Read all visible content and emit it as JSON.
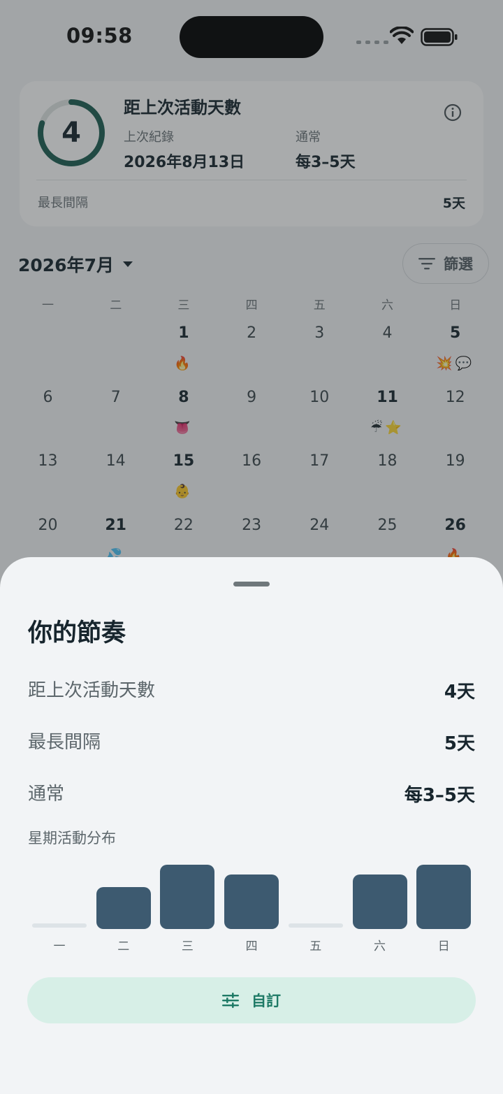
{
  "status_bar": {
    "time": "09:58"
  },
  "summary_card": {
    "days_since": "4",
    "ring_progress": 0.8,
    "title": "距上次活動天數",
    "last_record_label": "上次紀錄",
    "last_record_value": "2026年8月13日",
    "usual_label": "通常",
    "usual_value": "每3–5天",
    "longest_gap_label": "最長間隔",
    "longest_gap_value": "5天"
  },
  "calendar": {
    "month_label": "2026年7月",
    "filter_label": "篩選",
    "weekdays": [
      "一",
      "二",
      "三",
      "四",
      "五",
      "六",
      "日"
    ],
    "weeks": [
      [
        {
          "day": "",
          "bold": false,
          "emoji": ""
        },
        {
          "day": "",
          "bold": false,
          "emoji": ""
        },
        {
          "day": "1",
          "bold": true,
          "emoji": "🔥"
        },
        {
          "day": "2",
          "bold": false,
          "emoji": ""
        },
        {
          "day": "3",
          "bold": false,
          "emoji": ""
        },
        {
          "day": "4",
          "bold": false,
          "emoji": ""
        },
        {
          "day": "5",
          "bold": true,
          "emoji": "💥💬"
        }
      ],
      [
        {
          "day": "6",
          "bold": false,
          "emoji": ""
        },
        {
          "day": "7",
          "bold": false,
          "emoji": ""
        },
        {
          "day": "8",
          "bold": true,
          "emoji": "👅"
        },
        {
          "day": "9",
          "bold": false,
          "emoji": ""
        },
        {
          "day": "10",
          "bold": false,
          "emoji": ""
        },
        {
          "day": "11",
          "bold": true,
          "emoji": "☔⭐"
        },
        {
          "day": "12",
          "bold": false,
          "emoji": ""
        }
      ],
      [
        {
          "day": "13",
          "bold": false,
          "emoji": ""
        },
        {
          "day": "14",
          "bold": false,
          "emoji": ""
        },
        {
          "day": "15",
          "bold": true,
          "emoji": "👶"
        },
        {
          "day": "16",
          "bold": false,
          "emoji": ""
        },
        {
          "day": "17",
          "bold": false,
          "emoji": ""
        },
        {
          "day": "18",
          "bold": false,
          "emoji": ""
        },
        {
          "day": "19",
          "bold": false,
          "emoji": ""
        }
      ],
      [
        {
          "day": "20",
          "bold": false,
          "emoji": ""
        },
        {
          "day": "21",
          "bold": true,
          "emoji": "💦"
        },
        {
          "day": "22",
          "bold": false,
          "emoji": ""
        },
        {
          "day": "23",
          "bold": false,
          "emoji": ""
        },
        {
          "day": "24",
          "bold": false,
          "emoji": ""
        },
        {
          "day": "25",
          "bold": false,
          "emoji": ""
        },
        {
          "day": "26",
          "bold": true,
          "emoji": "🔥"
        }
      ]
    ]
  },
  "sheet": {
    "title": "你的節奏",
    "rows": [
      {
        "label": "距上次活動天數",
        "value": "4天"
      },
      {
        "label": "最長間隔",
        "value": "5天"
      },
      {
        "label": "通常",
        "value": "每3–5天"
      }
    ],
    "chart_title": "星期活動分布",
    "customize_label": "自訂"
  },
  "chart_data": {
    "type": "bar",
    "categories": [
      "一",
      "二",
      "三",
      "四",
      "五",
      "六",
      "日"
    ],
    "values": [
      0,
      0.65,
      1.0,
      0.85,
      0,
      0.85,
      1.0
    ],
    "ylim": [
      0,
      1
    ]
  },
  "colors": {
    "ring_accent": "#1d5e52",
    "bar_color": "#3d5a70",
    "button_bg": "#d7efe7",
    "button_text": "#1e7a66"
  }
}
